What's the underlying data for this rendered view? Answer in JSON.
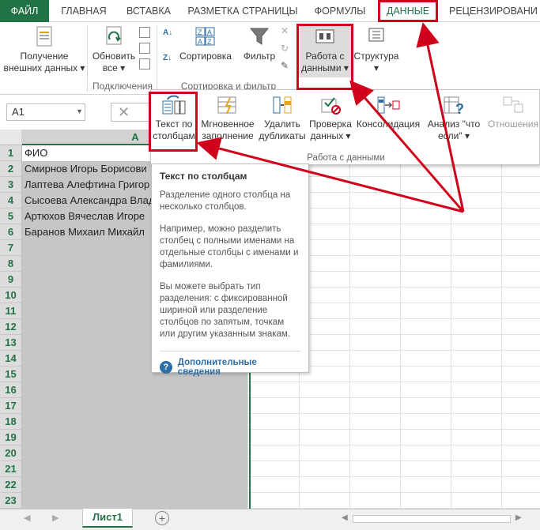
{
  "tabs": [
    "ФАЙЛ",
    "ГЛАВНАЯ",
    "ВСТАВКА",
    "РАЗМЕТКА СТРАНИЦЫ",
    "ФОРМУЛЫ",
    "ДАННЫЕ",
    "РЕЦЕНЗИРОВАНИ"
  ],
  "ribbon": {
    "get_external_line1": "Получение",
    "get_external_line2": "внешних данных",
    "refresh_line1": "Обновить",
    "refresh_line2": "все",
    "group_connections": "Подключения",
    "sort": "Сортировка",
    "filter": "Фильтр",
    "group_sort_filter": "Сортировка и фильтр",
    "data_tools_line1": "Работа с",
    "data_tools_line2": "данными",
    "outline": "Структура"
  },
  "formula_bar": {
    "name_box": "A1"
  },
  "panel": {
    "text_to_columns_line1": "Текст по",
    "text_to_columns_line2": "столбцам",
    "flash_fill_line1": "Мгновенное",
    "flash_fill_line2": "заполнение",
    "remove_dup_line1": "Удалить",
    "remove_dup_line2": "дубликаты",
    "validation_line1": "Проверка",
    "validation_line2": "данных",
    "consolidate": "Консолидация",
    "whatif_line1": "Анализ \"что",
    "whatif_line2": "если\"",
    "relationships": "Отношения",
    "group_label": "Работа с данными"
  },
  "tooltip": {
    "title": "Текст по столбцам",
    "p1": "Разделение одного столбца на несколько столбцов.",
    "p2": "Например, можно разделить столбец с полными именами на отдельные столбцы с именами и фамилиями.",
    "p3": "Вы можете выбрать тип разделения: с фиксированной шириной или разделение столбцов по запятым, точкам или другим указанным знакам.",
    "more": "Дополнительные сведения"
  },
  "grid": {
    "col_a": "A",
    "rows": [
      "1",
      "2",
      "3",
      "4",
      "5",
      "6",
      "7",
      "8",
      "9",
      "10",
      "11",
      "12",
      "13",
      "14",
      "15",
      "16",
      "17",
      "18",
      "19",
      "20",
      "21",
      "22",
      "23"
    ],
    "cells_a": [
      "ФИО",
      "Смирнов Игорь Борисови",
      "Лаптева Алефтина Григор",
      "Сысоева Александра Влад",
      "Артюхов Вячеслав Игоре",
      "Баранов Михаил Михайл"
    ]
  },
  "sheet_tab": "Лист1",
  "colors": {
    "accent": "#217346",
    "highlight": "#d0021b",
    "link": "#2e6ea6"
  }
}
